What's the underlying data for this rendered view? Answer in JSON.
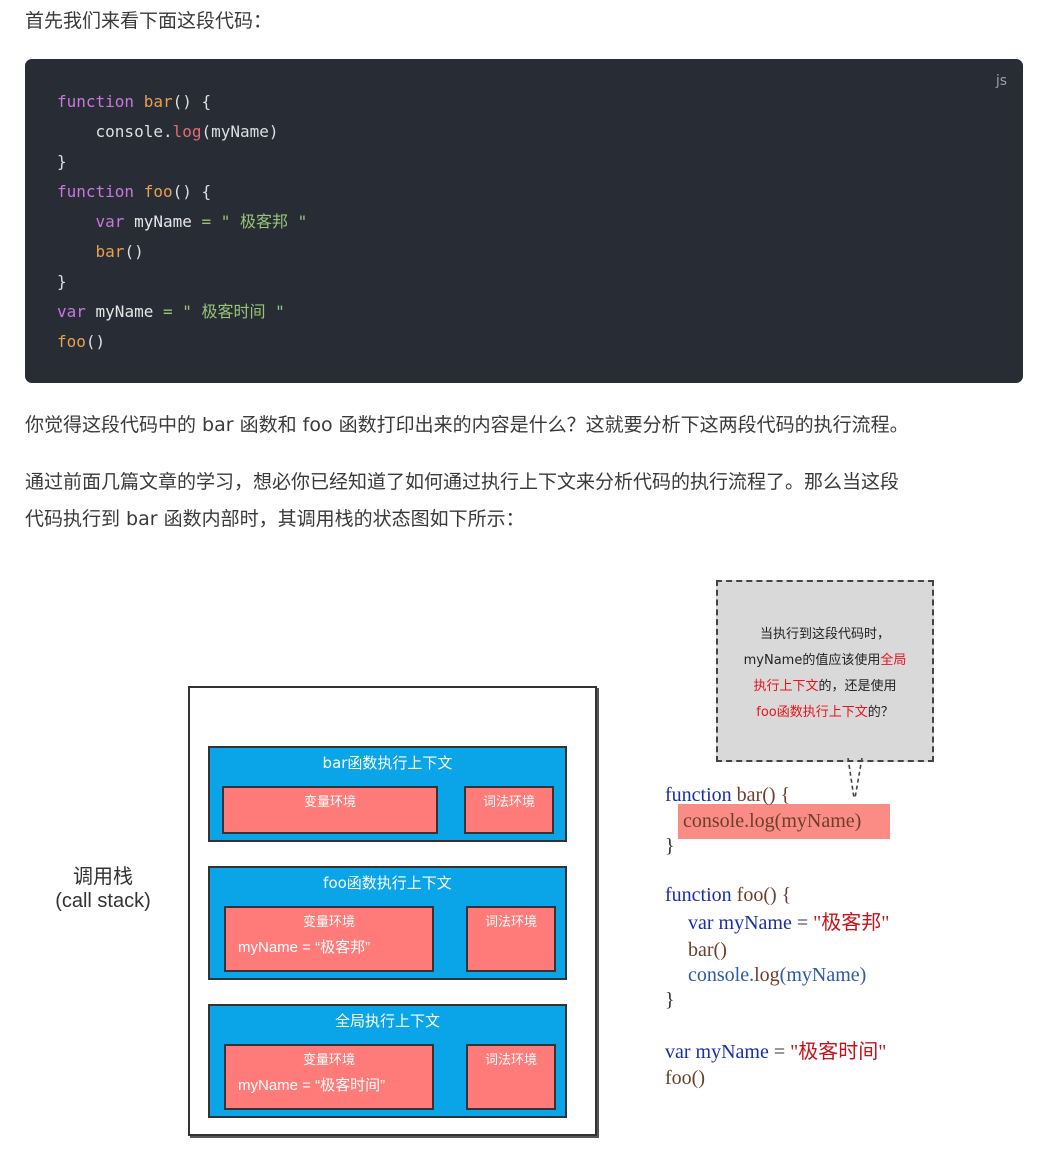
{
  "intro": "首先我们来看下面这段代码：",
  "code": {
    "lang": "js",
    "lines": [
      {
        "p1": "function",
        "p2": " bar",
        "p3": "() {"
      },
      {
        "p1": "    console.",
        "p2": "log",
        "p3": "(myName)"
      },
      {
        "p1": "}",
        "p2": "",
        "p3": ""
      },
      {
        "p1": "function",
        "p2": " foo",
        "p3": "() {"
      },
      {
        "p1": "    var",
        "p2": " myName ",
        "p3": "= \" 极客邦 \""
      },
      {
        "p1": "    ",
        "p2": "bar",
        "p3": "()"
      },
      {
        "p1": "}",
        "p2": "",
        "p3": ""
      },
      {
        "p1": "var",
        "p2": " myName ",
        "p3": "= \" 极客时间 \""
      },
      {
        "p1": "foo",
        "p2": "()",
        "p3": ""
      }
    ]
  },
  "para1": "你觉得这段代码中的 bar 函数和 foo 函数打印出来的内容是什么？这就要分析下这两段代码的执行流程。",
  "para2_line1": "通过前面几篇文章的学习，想必你已经知道了如何通过执行上下文来分析代码的执行流程了。那么当这段",
  "para2_line2": "代码执行到 bar 函数内部时，其调用栈的状态图如下所示：",
  "diagram": {
    "stack_label_1": "调用栈",
    "stack_label_2": "(call stack)",
    "contexts": [
      {
        "title": "bar函数执行上下文",
        "var_env": "变量环境",
        "var_value": "",
        "lex_env": "词法环境"
      },
      {
        "title": "foo函数执行上下文",
        "var_env": "变量环境",
        "var_value": "myName = “极客邦”",
        "lex_env": "词法环境"
      },
      {
        "title": "全局执行上下文",
        "var_env": "变量环境",
        "var_value": "myName = “极客时间”",
        "lex_env": "词法环境"
      }
    ],
    "bubble": {
      "line1": "当执行到这段代码时，",
      "line2_a": "myName的值应该使用",
      "line2_b": "全局",
      "line3_a": "执行上下文",
      "line3_b": "的，还是使用",
      "line4_a": "foo函数执行上下文",
      "line4_b": "的？"
    },
    "right_code": {
      "l1_kw": "function",
      "l1_rest": " bar() {",
      "l2_obj": "console.",
      "l2_fn": "log",
      "l2_rest": "(myName)",
      "l3": "}",
      "l4_kw": "function",
      "l4_rest": " foo() {",
      "l5_kw": "var",
      "l5_name": " myName",
      "l5_eq": " = ",
      "l5_str": "\"极客邦\"",
      "l6": "bar()",
      "l7_obj": "console.",
      "l7_fn": "log",
      "l7_rest": "(myName)",
      "l8": "}",
      "l9_kw": "var",
      "l9_name": " myName",
      "l9_eq": " = ",
      "l9_str": "\"极客时间\"",
      "l10": "foo()"
    }
  },
  "colors": {
    "code_bg": "#282c34",
    "context_blue": "#0aa4e8",
    "env_red": "#ff7b79",
    "bubble_grey": "#d9d9d9",
    "highlight": "#fb8c85"
  }
}
